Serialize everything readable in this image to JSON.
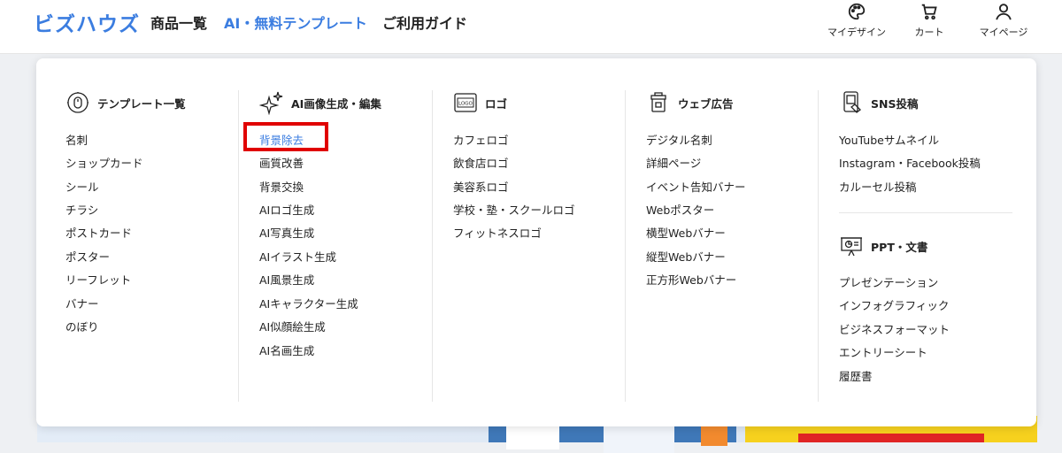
{
  "header": {
    "logo": "ビズハウズ",
    "nav": [
      {
        "label": "商品一覧"
      },
      {
        "label": "AI・無料テンプレート"
      },
      {
        "label": "ご利用ガイド"
      }
    ],
    "icons": [
      {
        "icon": "palette-icon",
        "label": "マイデザイン"
      },
      {
        "icon": "cart-icon",
        "label": "カート"
      },
      {
        "icon": "user-icon",
        "label": "マイページ"
      }
    ],
    "accent_color": "#3b7de0"
  },
  "menu": {
    "columns": [
      {
        "icon": "template-icon",
        "title": "テンプレート一覧",
        "items": [
          "名刺",
          "ショップカード",
          "シール",
          "チラシ",
          "ポストカード",
          "ポスター",
          "リーフレット",
          "バナー",
          "のぼり"
        ]
      },
      {
        "icon": "sparkle-icon",
        "title": "AI画像生成・編集",
        "items": [
          "背景除去",
          "画質改善",
          "背景交換",
          "AIロゴ生成",
          "AI写真生成",
          "AIイラスト生成",
          "AI風景生成",
          "AIキャラクター生成",
          "AI似顔絵生成",
          "AI名画生成"
        ]
      },
      {
        "icon": "logo-icon",
        "icon_text": "LOGO",
        "title": "ロゴ",
        "items": [
          "カフェロゴ",
          "飲食店ロゴ",
          "美容系ロゴ",
          "学校・塾・スクールロゴ",
          "フィットネスロゴ"
        ]
      },
      {
        "icon": "web-ad-icon",
        "title": "ウェブ広告",
        "items": [
          "デジタル名刺",
          "詳細ページ",
          "イベント告知バナー",
          "Webポスター",
          "横型Webバナー",
          "縦型Webバナー",
          "正方形Webバナー"
        ]
      },
      {
        "icon": "sns-icon",
        "title": "SNS投稿",
        "items": [
          "YouTubeサムネイル",
          "Instagram・Facebook投稿",
          "カルーセル投稿"
        ],
        "sub_icon": "presentation-icon",
        "sub_title": "PPT・文書",
        "sub_items": [
          "プレゼンテーション",
          "インフォグラフィック",
          "ビジネスフォーマット",
          "エントリーシート",
          "履歴書"
        ]
      }
    ],
    "highlight_color": "#e00000"
  }
}
